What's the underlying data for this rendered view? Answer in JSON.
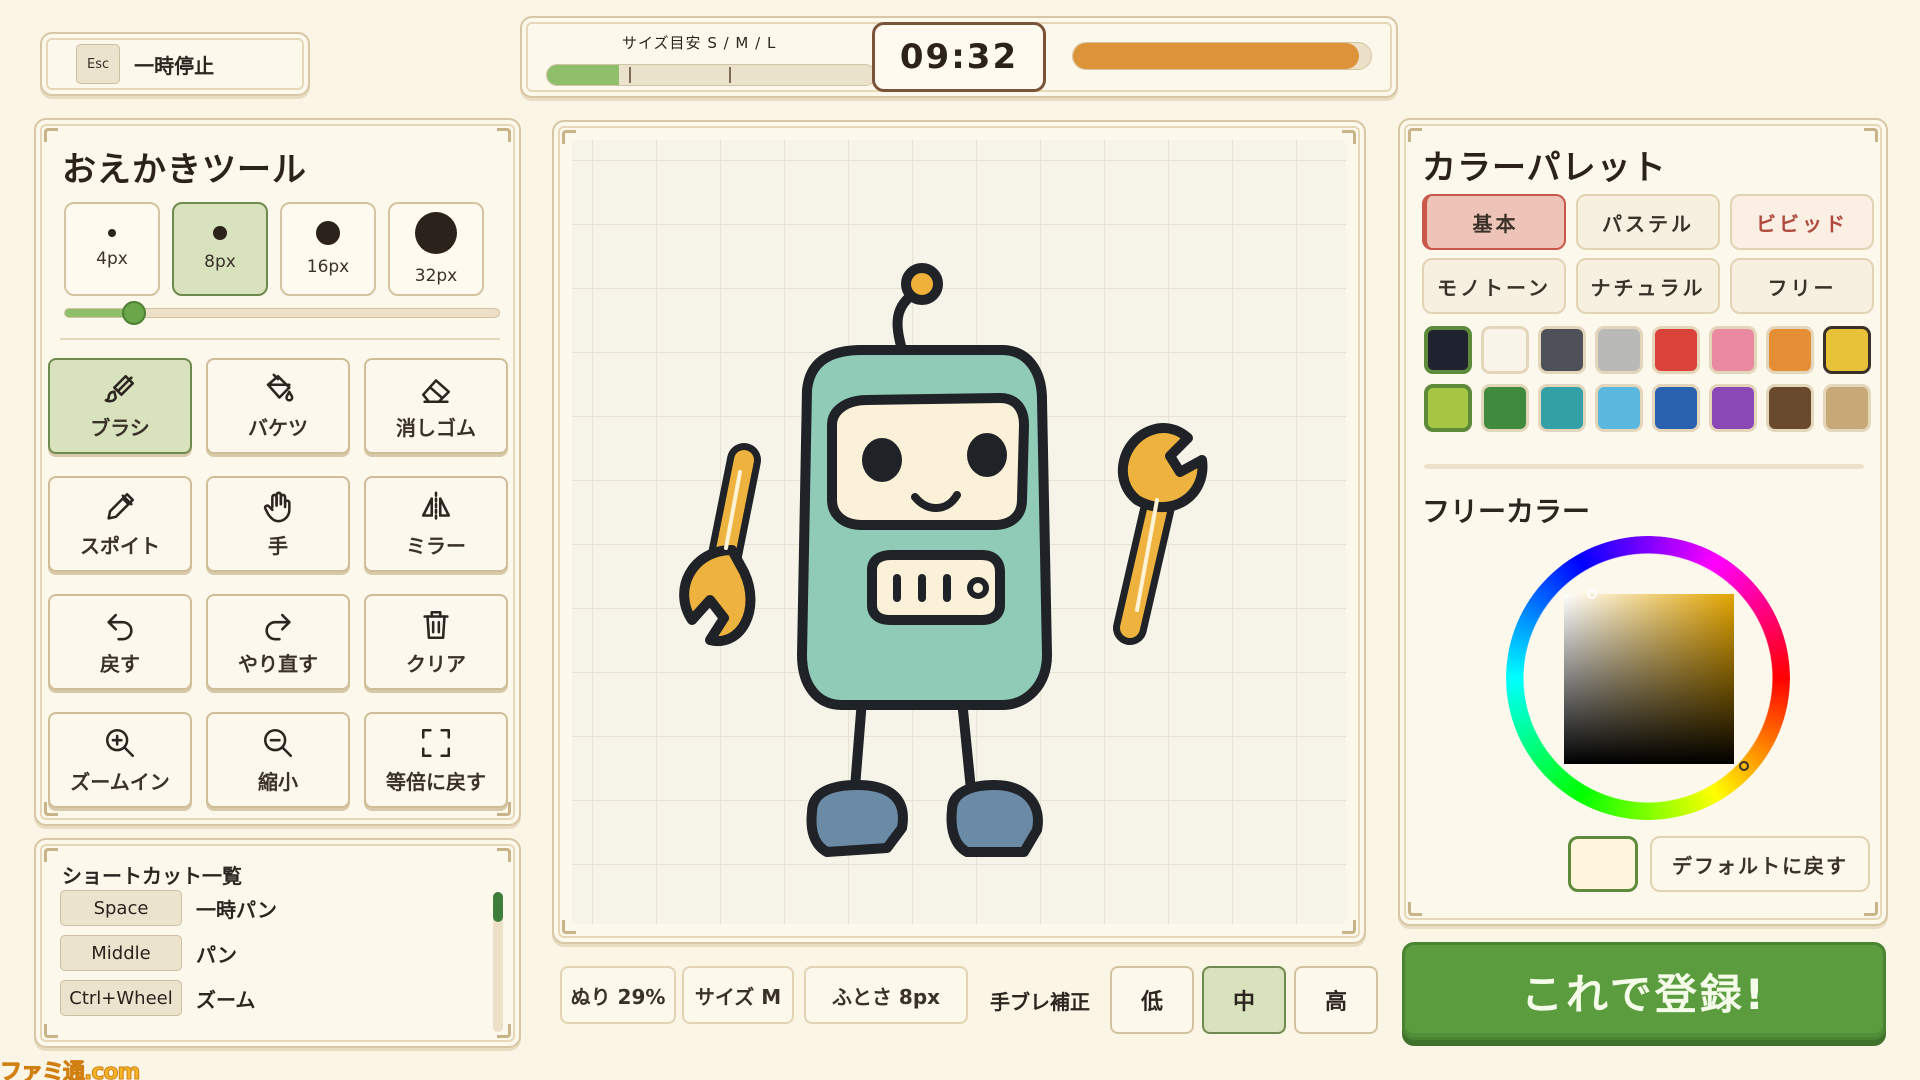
{
  "pause": {
    "key": "Esc",
    "label": "一時停止"
  },
  "topbar": {
    "size_guide_label": "サイズ目安 S / M / L",
    "size_guide_fill": 0.22,
    "timer": "09:32",
    "time_remaining_fraction": 0.96
  },
  "tools": {
    "title": "おえかきツール",
    "brush_sizes": [
      {
        "label": "4px",
        "active": false
      },
      {
        "label": "8px",
        "active": true
      },
      {
        "label": "16px",
        "active": false
      },
      {
        "label": "32px",
        "active": false
      }
    ],
    "brush_slider_fraction": 0.16,
    "buttons": [
      {
        "label": "ブラシ",
        "icon": "brush-icon",
        "active": true
      },
      {
        "label": "バケツ",
        "icon": "bucket-icon",
        "active": false
      },
      {
        "label": "消しゴム",
        "icon": "eraser-icon",
        "active": false
      },
      {
        "label": "スポイト",
        "icon": "eyedropper-icon",
        "active": false
      },
      {
        "label": "手",
        "icon": "hand-icon",
        "active": false
      },
      {
        "label": "ミラー",
        "icon": "mirror-icon",
        "active": false
      },
      {
        "label": "戻す",
        "icon": "undo-icon",
        "active": false
      },
      {
        "label": "やり直す",
        "icon": "redo-icon",
        "active": false
      },
      {
        "label": "クリア",
        "icon": "trash-icon",
        "active": false
      },
      {
        "label": "ズームイン",
        "icon": "zoom-in-icon",
        "active": false
      },
      {
        "label": "縮小",
        "icon": "zoom-out-icon",
        "active": false
      },
      {
        "label": "等倍に戻す",
        "icon": "fit-screen-icon",
        "active": false
      }
    ]
  },
  "shortcuts": {
    "title": "ショートカット一覧",
    "items": [
      {
        "key": "Space",
        "desc": "一時パン"
      },
      {
        "key": "Middle",
        "desc": "パン"
      },
      {
        "key": "Ctrl+Wheel",
        "desc": "ズーム"
      }
    ]
  },
  "status": {
    "fill": "ぬり 29%",
    "size": "サイズ M",
    "thickness": "ふとさ 8px",
    "stabilizer_label": "手ブレ補正",
    "stabilizer_options": [
      "低",
      "中",
      "高"
    ],
    "stabilizer_selected": "中"
  },
  "palette": {
    "title": "カラーパレット",
    "tabs": [
      "基本",
      "パステル",
      "ビビッド",
      "モノトーン",
      "ナチュラル",
      "フリー"
    ],
    "active_tab": "基本",
    "swatches": [
      "#1f2330",
      "#f8f4ea",
      "#4e5258",
      "#b9b9b7",
      "#d9433a",
      "#e98aa0",
      "#e58e35",
      "#e8c33a",
      "#a6c644",
      "#3f8a3d",
      "#33a0a6",
      "#5ab7de",
      "#2a62b0",
      "#8a48b6",
      "#6a4a2c",
      "#c7a978"
    ],
    "selected_swatches": [
      "#1f2330",
      "#e8c33a",
      "#a6c644"
    ],
    "free_title": "フリーカラー",
    "current_color": "#fff5dc",
    "picker_hue": "#e2a400",
    "reset_label": "デフォルトに戻す"
  },
  "register_label": "これで登録!",
  "watermark": "ファミ通.com"
}
